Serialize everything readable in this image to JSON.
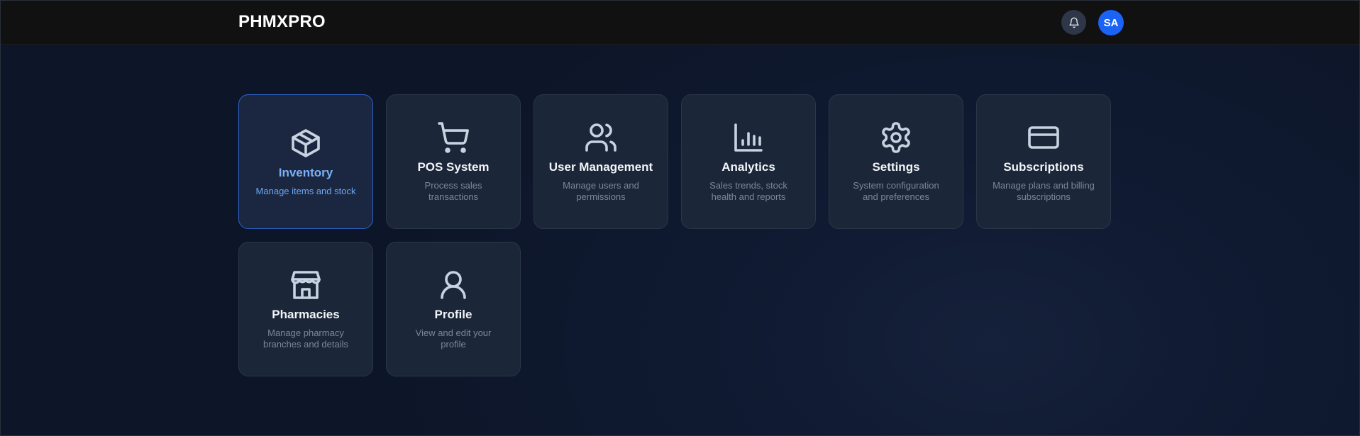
{
  "header": {
    "brand": "PHMXPRO",
    "avatar_initials": "SA",
    "notification_icon": "bell-icon"
  },
  "colors": {
    "accent": "#1b63f5",
    "active_text": "#7ab0f5",
    "card_bg": "#1b2638",
    "page_bg": "#0e1629"
  },
  "cards": [
    {
      "title": "Inventory",
      "description": "Manage items and stock",
      "icon": "box-icon",
      "active": true
    },
    {
      "title": "POS System",
      "description": "Process sales transactions",
      "icon": "cart-icon",
      "active": false
    },
    {
      "title": "User Management",
      "description": "Manage users and permissions",
      "icon": "users-icon",
      "active": false
    },
    {
      "title": "Analytics",
      "description": "Sales trends, stock health and reports",
      "icon": "bar-chart-icon",
      "active": false
    },
    {
      "title": "Settings",
      "description": "System configuration and preferences",
      "icon": "gear-icon",
      "active": false
    },
    {
      "title": "Subscriptions",
      "description": "Manage plans and billing subscriptions",
      "icon": "credit-card-icon",
      "active": false
    },
    {
      "title": "Pharmacies",
      "description": "Manage pharmacy branches and details",
      "icon": "store-icon",
      "active": false
    },
    {
      "title": "Profile",
      "description": "View and edit your profile",
      "icon": "user-icon",
      "active": false
    }
  ]
}
